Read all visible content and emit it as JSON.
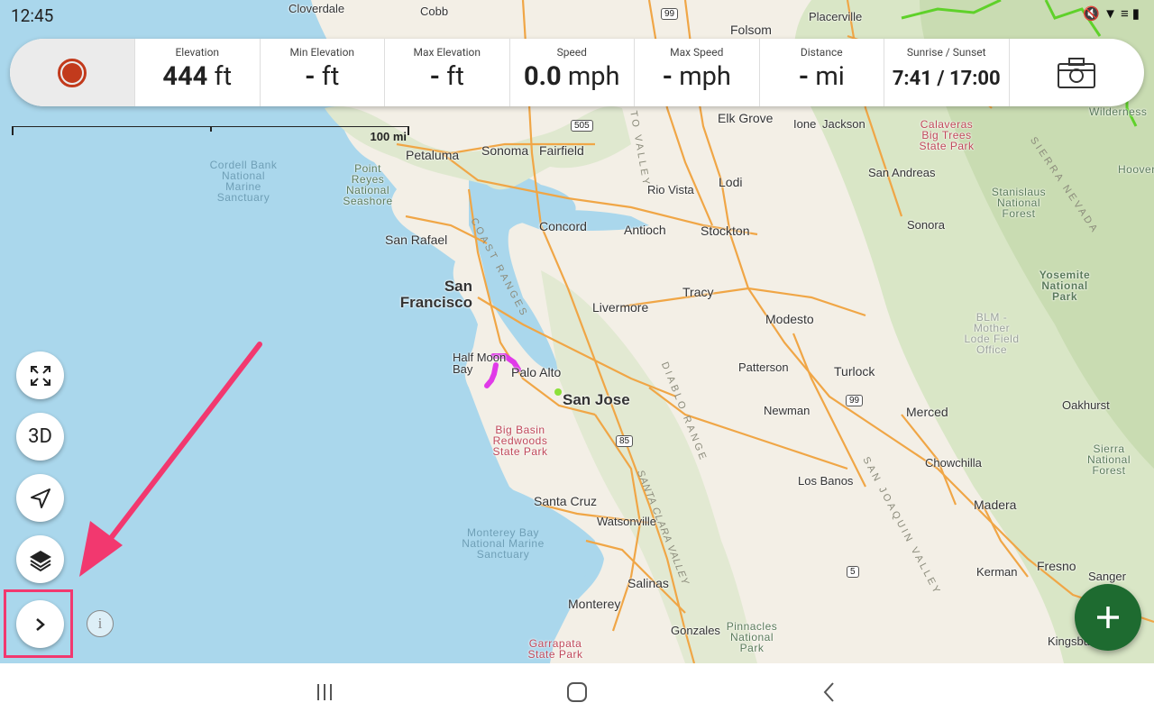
{
  "status_bar": {
    "time": "12:45"
  },
  "stats": {
    "elevation": {
      "label": "Elevation",
      "value": "444",
      "unit": "ft"
    },
    "min_elevation": {
      "label": "Min Elevation",
      "value": "-",
      "unit": "ft"
    },
    "max_elevation": {
      "label": "Max Elevation",
      "value": "-",
      "unit": "ft"
    },
    "speed": {
      "label": "Speed",
      "value": "0.0",
      "unit": "mph"
    },
    "max_speed": {
      "label": "Max Speed",
      "value": "-",
      "unit": "mph"
    },
    "distance": {
      "label": "Distance",
      "value": "-",
      "unit": "mi"
    },
    "sunrise_sunset": {
      "label": "Sunrise / Sunset",
      "value": "7:41 / 17:00"
    }
  },
  "scale": {
    "label": "100 mi"
  },
  "controls": {
    "three_d_label": "3D",
    "info_label": "i"
  },
  "map": {
    "cities": [
      {
        "name": "Cloverdale"
      },
      {
        "name": "Cobb"
      },
      {
        "name": "Placerville"
      },
      {
        "name": "Folsom"
      },
      {
        "name": "Elk Grove"
      },
      {
        "name": "Ione"
      },
      {
        "name": "Jackson"
      },
      {
        "name": "Petaluma"
      },
      {
        "name": "Sonoma"
      },
      {
        "name": "Fairfield"
      },
      {
        "name": "Rio Vista"
      },
      {
        "name": "Lodi"
      },
      {
        "name": "San Andreas"
      },
      {
        "name": "Sonora"
      },
      {
        "name": "San Rafael"
      },
      {
        "name": "Concord"
      },
      {
        "name": "Antioch"
      },
      {
        "name": "Stockton"
      },
      {
        "name": "San Francisco"
      },
      {
        "name": "Livermore"
      },
      {
        "name": "Tracy"
      },
      {
        "name": "Modesto"
      },
      {
        "name": "Half Moon Bay"
      },
      {
        "name": "Palo Alto"
      },
      {
        "name": "San Jose"
      },
      {
        "name": "Patterson"
      },
      {
        "name": "Turlock"
      },
      {
        "name": "Newman"
      },
      {
        "name": "Merced"
      },
      {
        "name": "Oakhurst"
      },
      {
        "name": "Chowchilla"
      },
      {
        "name": "Los Banos"
      },
      {
        "name": "Santa Cruz"
      },
      {
        "name": "Watsonville"
      },
      {
        "name": "Madera"
      },
      {
        "name": "Kerman"
      },
      {
        "name": "Fresno"
      },
      {
        "name": "Sanger"
      },
      {
        "name": "Salinas"
      },
      {
        "name": "Monterey"
      },
      {
        "name": "Gonzales"
      },
      {
        "name": "Kingsburg"
      }
    ],
    "parks": [
      {
        "name": "Cordell Bank National Marine Sanctuary"
      },
      {
        "name": "Point Reyes National Seashore"
      },
      {
        "name": "Calaveras Big Trees State Park"
      },
      {
        "name": "Stanislaus National Forest"
      },
      {
        "name": "Yosemite National Park"
      },
      {
        "name": "BLM - Mother Lode Field Office"
      },
      {
        "name": "Sierra National Forest"
      },
      {
        "name": "Big Basin Redwoods State Park"
      },
      {
        "name": "Monterey Bay National Marine Sanctuary"
      },
      {
        "name": "Pinnacles National Park"
      },
      {
        "name": "Garrapata State Park"
      },
      {
        "name": "Wilderness"
      },
      {
        "name": "Hoover"
      }
    ],
    "ranges": [
      {
        "name": "COAST RANGES"
      },
      {
        "name": "DIABLO RANGE"
      },
      {
        "name": "SAN JOAQUIN VALLEY"
      },
      {
        "name": "SIERRA NEVADA"
      },
      {
        "name": "SANTA CLARA VALLEY"
      },
      {
        "name": "TO VALLEY"
      }
    ],
    "highways": [
      "99",
      "505",
      "99",
      "85",
      "5"
    ]
  },
  "colors": {
    "accent_record": "#c23a1c",
    "fab_green": "#1e6b30",
    "highlight": "#f2386f"
  }
}
